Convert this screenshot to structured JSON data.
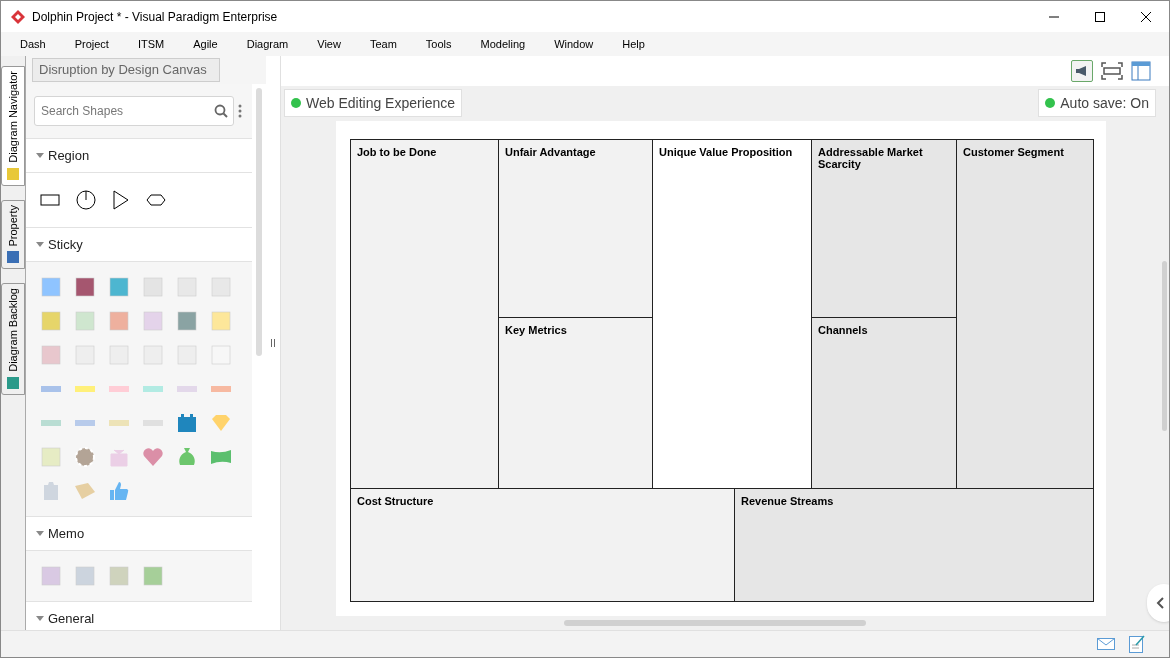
{
  "window": {
    "title": "Dolphin Project * - Visual Paradigm Enterprise"
  },
  "menu": [
    "Dash",
    "Project",
    "ITSM",
    "Agile",
    "Diagram",
    "View",
    "Team",
    "Tools",
    "Modeling",
    "Window",
    "Help"
  ],
  "side_tabs": [
    {
      "label": "Diagram Navigator",
      "selected": true
    },
    {
      "label": "Property",
      "selected": false
    },
    {
      "label": "Diagram Backlog",
      "selected": false
    }
  ],
  "breadcrumb": "Disruption by Design Canvas",
  "palette": {
    "search": {
      "placeholder": "Search Shapes"
    },
    "sections": [
      {
        "title": "Region",
        "kind": "region"
      },
      {
        "title": "Sticky",
        "kind": "sticky"
      },
      {
        "title": "Memo",
        "kind": "memo"
      },
      {
        "title": "General",
        "kind": "general"
      }
    ]
  },
  "canvas": {
    "web_editing": {
      "label": "Web Editing Experience"
    },
    "auto_save": {
      "label": "Auto save: On"
    },
    "blocks": [
      {
        "title": "Job to be Done",
        "color": "#f2f2f2"
      },
      {
        "title": "Unfair Advantage",
        "color": "#f2f2f2"
      },
      {
        "title": "Unique Value Proposition",
        "color": "#ffffff"
      },
      {
        "title": "Addressable Market Scarcity",
        "color": "#e6e6e6"
      },
      {
        "title": "Customer Segment",
        "color": "#e6e6e6"
      },
      {
        "title": "Key Metrics",
        "color": "#f2f2f2"
      },
      {
        "title": "Channels",
        "color": "#e6e6e6"
      },
      {
        "title": "Cost Structure",
        "color": "#f2f2f2"
      },
      {
        "title": "Revenue Streams",
        "color": "#e6e6e6"
      }
    ]
  }
}
